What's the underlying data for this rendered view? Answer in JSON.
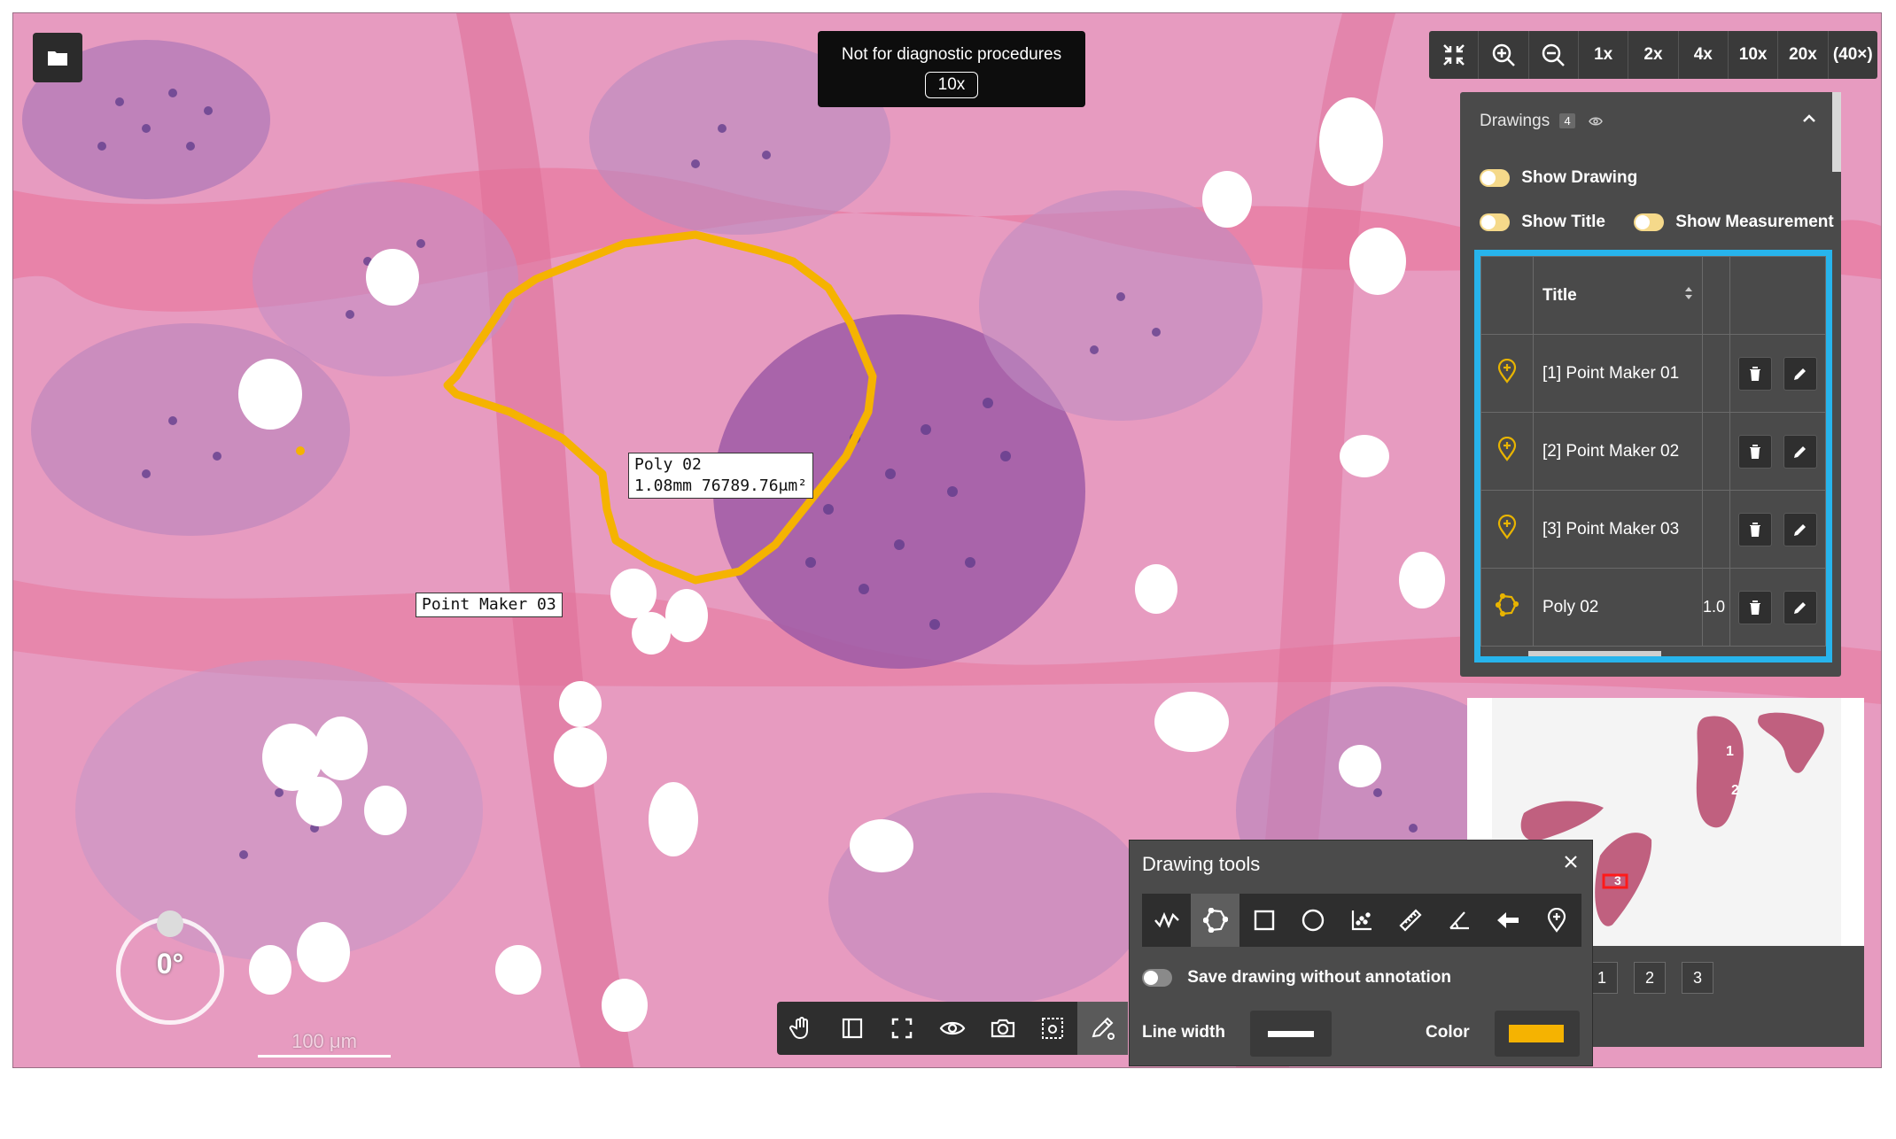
{
  "notice": {
    "text": "Not for diagnostic procedures",
    "magnification": "10x"
  },
  "zoombar": {
    "buttons": [
      {
        "name": "fit-icon"
      },
      {
        "name": "zoom-in-icon"
      },
      {
        "name": "zoom-out-icon"
      }
    ],
    "levels": [
      "1x",
      "2x",
      "4x",
      "10x",
      "20x",
      "(40×)"
    ]
  },
  "annotations": {
    "poly_title": "Poly 02",
    "poly_measure": "1.08mm 76789.76μm²",
    "point_label": "Point Maker 03"
  },
  "rotation": {
    "angle": "0°"
  },
  "scalebar": {
    "label": "100 μm"
  },
  "drawings_panel": {
    "header": "Drawings",
    "count": "4",
    "show_drawing": "Show Drawing",
    "show_title": "Show Title",
    "show_measurement": "Show Measurement",
    "table": {
      "column_title": "Title",
      "rows": [
        {
          "icon": "point-marker-icon",
          "title": "[1] Point Maker 01",
          "measurement": ""
        },
        {
          "icon": "point-marker-icon",
          "title": "[2] Point Maker 02",
          "measurement": ""
        },
        {
          "icon": "point-marker-icon",
          "title": "[3] Point Maker 03",
          "measurement": ""
        },
        {
          "icon": "polygon-icon",
          "title": "Poly 02",
          "measurement": "1.0"
        }
      ]
    }
  },
  "minimap": {
    "labels": [
      "1",
      "2",
      "3"
    ],
    "pages": [
      "1",
      "2",
      "3"
    ]
  },
  "drawing_tools": {
    "title": "Drawing tools",
    "tools": [
      "freehand-icon",
      "polygon-icon",
      "rectangle-icon",
      "ellipse-icon",
      "scatter-icon",
      "ruler-icon",
      "angle-icon",
      "arrow-icon",
      "point-marker-icon"
    ],
    "save_without_annotation": "Save drawing without annotation",
    "line_width_label": "Line width",
    "color_label": "Color",
    "color_value": "#f5b301"
  },
  "colors": {
    "accent": "#27b4ec",
    "drawing": "#f5b301",
    "marker": "#e8b400"
  }
}
